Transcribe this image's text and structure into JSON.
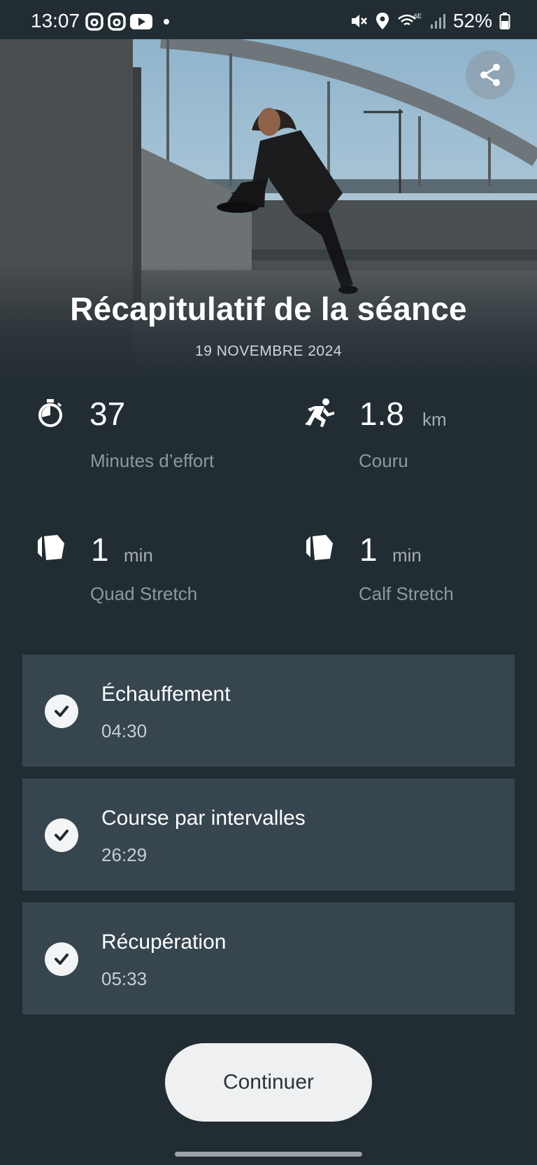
{
  "status_bar": {
    "time": "13:07",
    "battery": "52%",
    "left_icons": [
      "threads-icon",
      "threads-icon",
      "youtube-icon",
      "dot-icon"
    ],
    "right_icons": [
      "mute-icon",
      "location-icon",
      "wifi-6e-icon",
      "signal-icon",
      "battery-icon"
    ]
  },
  "hero": {
    "title": "Récapitulatif de la séance",
    "date": "19 NOVEMBRE 2024",
    "share_icon": "share-icon"
  },
  "stats": [
    {
      "icon": "stopwatch-icon",
      "value": "37",
      "unit": "",
      "label": "Minutes d’effort"
    },
    {
      "icon": "runner-icon",
      "value": "1.8",
      "unit": "km",
      "label": "Couru"
    },
    {
      "icon": "stretch-icon",
      "value": "1",
      "unit": "min",
      "label": "Quad Stretch"
    },
    {
      "icon": "stretch-icon",
      "value": "1",
      "unit": "min",
      "label": "Calf Stretch"
    }
  ],
  "phases": [
    {
      "name": "Échauffement",
      "time": "04:30",
      "done": true
    },
    {
      "name": "Course par intervalles",
      "time": "26:29",
      "done": true
    },
    {
      "name": "Récupération",
      "time": "05:33",
      "done": true
    }
  ],
  "continue_label": "Continuer",
  "colors": {
    "background": "#222d33",
    "card": "#36454e",
    "button": "#eef0f1"
  }
}
